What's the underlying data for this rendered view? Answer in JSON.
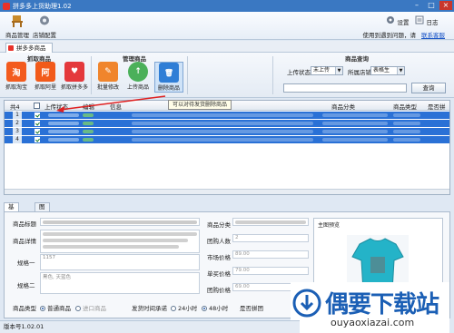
{
  "window": {
    "title": "拼多多上货助理1.02"
  },
  "topbar": {
    "buttons": [
      {
        "label": "商品管理"
      },
      {
        "label": "店铺配置"
      }
    ],
    "right_buttons": [
      {
        "label": "设置"
      },
      {
        "label": "日志"
      }
    ],
    "help_text": "使用到遇到问题，请",
    "help_link": "联系客服"
  },
  "tabs": [
    {
      "label": "拼多多商品"
    }
  ],
  "ribbon": {
    "group_fetch": "抓取商品",
    "group_manage": "管理商品",
    "group_query": "商品查询",
    "buttons": [
      {
        "label": "抓取淘宝",
        "glyph": "淘",
        "color": "#f35b1e"
      },
      {
        "label": "抓取阿里",
        "glyph": "阿",
        "color": "#f25a1a"
      },
      {
        "label": "抓取拼多多",
        "glyph": "♥",
        "color": "#e4393c"
      },
      {
        "label": "批量修改",
        "glyph": "✎",
        "color": "#f0852c"
      },
      {
        "label": "上传商品",
        "glyph": "↑",
        "color": "#4bb05a"
      },
      {
        "label": "删除商品",
        "glyph": "🗑",
        "color": "#2f7ed6"
      }
    ],
    "query": {
      "status_label": "上传状态",
      "status_value": "未上传",
      "shop_label": "所属店铺",
      "shop_value": "表格生",
      "search_placeholder": "",
      "search_button": "查询"
    }
  },
  "grid": {
    "headers": [
      "共4",
      "",
      "上传状态",
      "编辑",
      "信息",
      "",
      "商品分类",
      "",
      "商品类型",
      "是否拼团"
    ],
    "rows": [
      {
        "num": "1"
      },
      {
        "num": "2"
      },
      {
        "num": "3"
      },
      {
        "num": "4"
      }
    ],
    "tooltip": "可以对待发货删除商品"
  },
  "detail": {
    "tabs": [
      "基本信息",
      "图片信息"
    ],
    "fields_left": [
      {
        "label": "商品标题"
      },
      {
        "label": "商品详情"
      },
      {
        "label": "规格一",
        "value": "1157"
      },
      {
        "label": "规格二",
        "value": "黑色, 天蓝色"
      }
    ],
    "fields_right": [
      {
        "label": "商品分类"
      },
      {
        "label": "团购人数",
        "value": "2"
      },
      {
        "label": "市场价格",
        "value": "89.00"
      },
      {
        "label": "单买价格",
        "value": "79.00"
      },
      {
        "label": "团购价格",
        "value": "69.00"
      }
    ],
    "image_panel_label": "主图预览",
    "type_label": "商品类型",
    "type_options": [
      "普通商品",
      "进口商品"
    ],
    "ship_label": "发货时间承诺",
    "ship_options": [
      "24小时",
      "48小时"
    ],
    "group_label": "是否拼团"
  },
  "status": {
    "version": "版本号1.02.01"
  },
  "watermark": {
    "title": "偶要下载站",
    "url": "ouyaoxiazai.com"
  },
  "colors": {
    "selection_blue": "#2a71d6",
    "title_blue": "#3a78c2"
  }
}
